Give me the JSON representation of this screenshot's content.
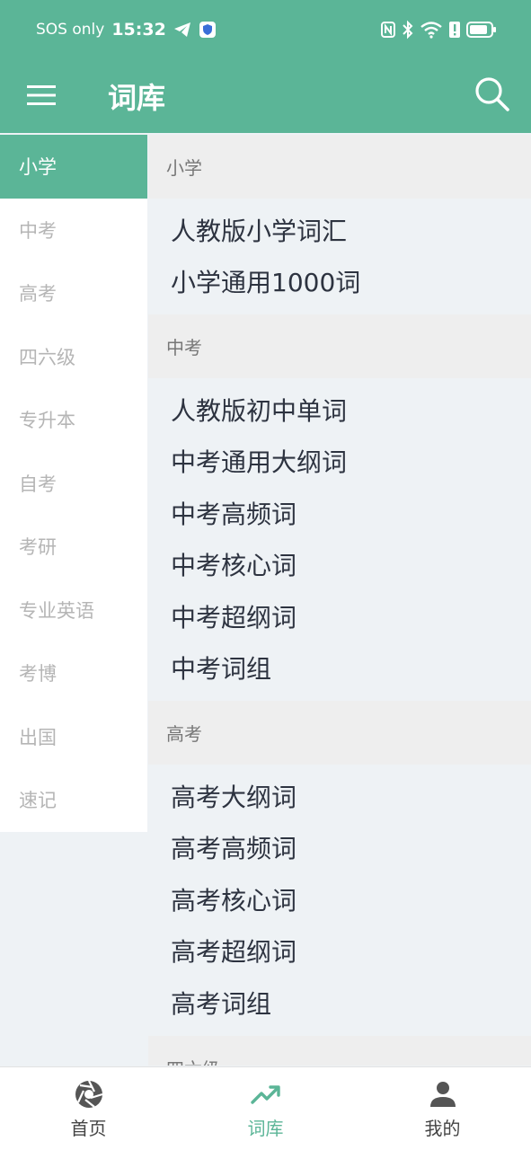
{
  "status_bar": {
    "carrier": "SOS only",
    "time": "15:32"
  },
  "appbar": {
    "title": "词库",
    "menu_icon": "menu-icon",
    "search_icon": "search-icon"
  },
  "colors": {
    "primary": "#5bb597",
    "text_dark": "#2d3340",
    "sidebar_inactive": "#b5b5b5"
  },
  "sidebar": {
    "items": [
      {
        "label": "小学",
        "active": true
      },
      {
        "label": "中考",
        "active": false
      },
      {
        "label": "高考",
        "active": false
      },
      {
        "label": "四六级",
        "active": false
      },
      {
        "label": "专升本",
        "active": false
      },
      {
        "label": "自考",
        "active": false
      },
      {
        "label": "考研",
        "active": false
      },
      {
        "label": "专业英语",
        "active": false
      },
      {
        "label": "考博",
        "active": false
      },
      {
        "label": "出国",
        "active": false
      },
      {
        "label": "速记",
        "active": false
      }
    ]
  },
  "content": {
    "sections": [
      {
        "title": "小学",
        "items": [
          "人教版小学词汇",
          "小学通用1000词"
        ]
      },
      {
        "title": "中考",
        "items": [
          "人教版初中单词",
          "中考通用大纲词",
          "中考高频词",
          "中考核心词",
          "中考超纲词",
          "中考词组"
        ]
      },
      {
        "title": "高考",
        "items": [
          "高考大纲词",
          "高考高频词",
          "高考核心词",
          "高考超纲词",
          "高考词组"
        ]
      },
      {
        "title": "四六级",
        "items": []
      }
    ]
  },
  "bottom_nav": {
    "items": [
      {
        "label": "首页",
        "icon": "aperture-icon",
        "active": false
      },
      {
        "label": "词库",
        "icon": "trending-up-icon",
        "active": true
      },
      {
        "label": "我的",
        "icon": "person-icon",
        "active": false
      }
    ]
  }
}
